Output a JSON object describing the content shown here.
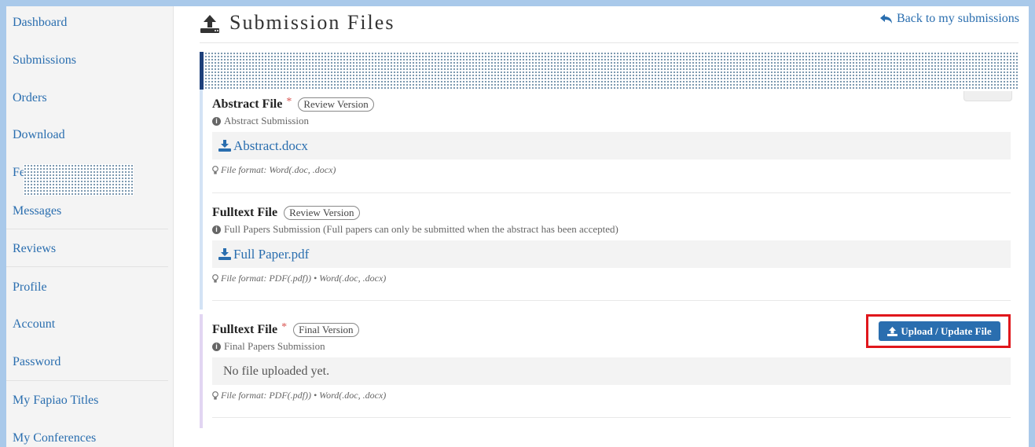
{
  "sidebar": {
    "items": [
      {
        "label": "Dashboard"
      },
      {
        "label": "Submissions"
      },
      {
        "label": "Orders"
      },
      {
        "label": "Download"
      },
      {
        "label": "Fe"
      },
      {
        "label": "Messages"
      },
      {
        "label": "Reviews"
      },
      {
        "label": "Profile"
      },
      {
        "label": "Account"
      },
      {
        "label": "Password"
      },
      {
        "label": "My Fapiao Titles"
      },
      {
        "label": "My Conferences"
      }
    ]
  },
  "header": {
    "title": "Submission Files",
    "back_link": "Back to my submissions"
  },
  "sections": [
    {
      "title": "Abstract File",
      "required": "*",
      "badge": "Review Version",
      "description": "Abstract Submission",
      "file_name": "Abstract.docx",
      "format": "File format: Word(.doc, .docx)"
    },
    {
      "title": "Fulltext File",
      "required": "",
      "badge": "Review Version",
      "description": "Full Papers Submission (Full papers can only be submitted when the abstract has been accepted)",
      "file_name": "Full Paper.pdf",
      "format": "File format: PDF(.pdf)) • Word(.doc, .docx)"
    },
    {
      "title": "Fulltext File",
      "required": "*",
      "badge": "Final Version",
      "description": "Final Papers Submission",
      "empty_text": "No file uploaded yet.",
      "format": "File format: PDF(.pdf)) • Word(.doc, .docx)",
      "upload_button": "Upload / Update File"
    }
  ],
  "colors": {
    "link": "#2a6eaf",
    "button": "#2a6eaf",
    "required": "#d9534f",
    "highlight_outline": "#e0171c",
    "banner_bar": "#1c3f7a",
    "frame_border": "#a9c9ea"
  },
  "icons": {
    "title": "upload-icon",
    "back": "reply-arrow-icon",
    "info": "info-circle-icon",
    "download": "download-icon",
    "format": "lightbulb-icon"
  }
}
